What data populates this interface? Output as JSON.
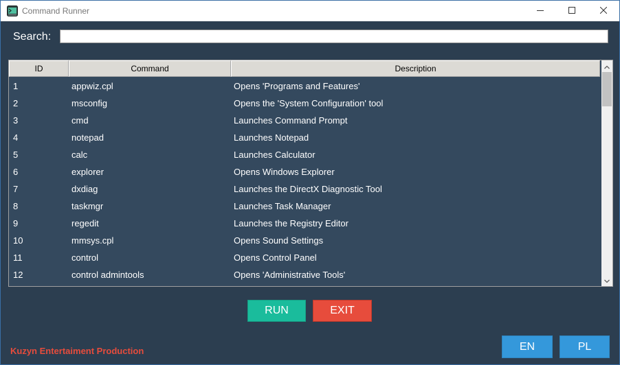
{
  "window": {
    "title": "Command Runner",
    "minimize_glyph": "—",
    "maximize_glyph": "☐",
    "close_glyph": "✕",
    "icon": "terminal-icon"
  },
  "search": {
    "label": "Search:",
    "value": "",
    "placeholder": ""
  },
  "table": {
    "columns": [
      "ID",
      "Command",
      "Description"
    ],
    "rows": [
      {
        "id": "1",
        "command": "appwiz.cpl",
        "description": "Opens 'Programs and Features'"
      },
      {
        "id": "2",
        "command": "msconfig",
        "description": "Opens the 'System Configuration' tool"
      },
      {
        "id": "3",
        "command": "cmd",
        "description": "Launches Command Prompt"
      },
      {
        "id": "4",
        "command": "notepad",
        "description": "Launches Notepad"
      },
      {
        "id": "5",
        "command": "calc",
        "description": "Launches Calculator"
      },
      {
        "id": "6",
        "command": "explorer",
        "description": "Opens Windows Explorer"
      },
      {
        "id": "7",
        "command": "dxdiag",
        "description": "Launches the DirectX Diagnostic Tool"
      },
      {
        "id": "8",
        "command": "taskmgr",
        "description": "Launches Task Manager"
      },
      {
        "id": "9",
        "command": "regedit",
        "description": "Launches the Registry Editor"
      },
      {
        "id": "10",
        "command": "mmsys.cpl",
        "description": "Opens Sound Settings"
      },
      {
        "id": "11",
        "command": "control",
        "description": "Opens Control Panel"
      },
      {
        "id": "12",
        "command": "control admintools",
        "description": "Opens 'Administrative Tools'"
      }
    ]
  },
  "actions": {
    "run_label": "RUN",
    "exit_label": "EXIT"
  },
  "language": {
    "en_label": "EN",
    "pl_label": "PL"
  },
  "footer": {
    "credit": "Kuzyn Entertaiment Production"
  },
  "colors": {
    "background": "#2c3e50",
    "table_background": "#34495e",
    "run": "#1abc9c",
    "exit": "#e74c3c",
    "language": "#3498db",
    "credit": "#e74c3c"
  }
}
